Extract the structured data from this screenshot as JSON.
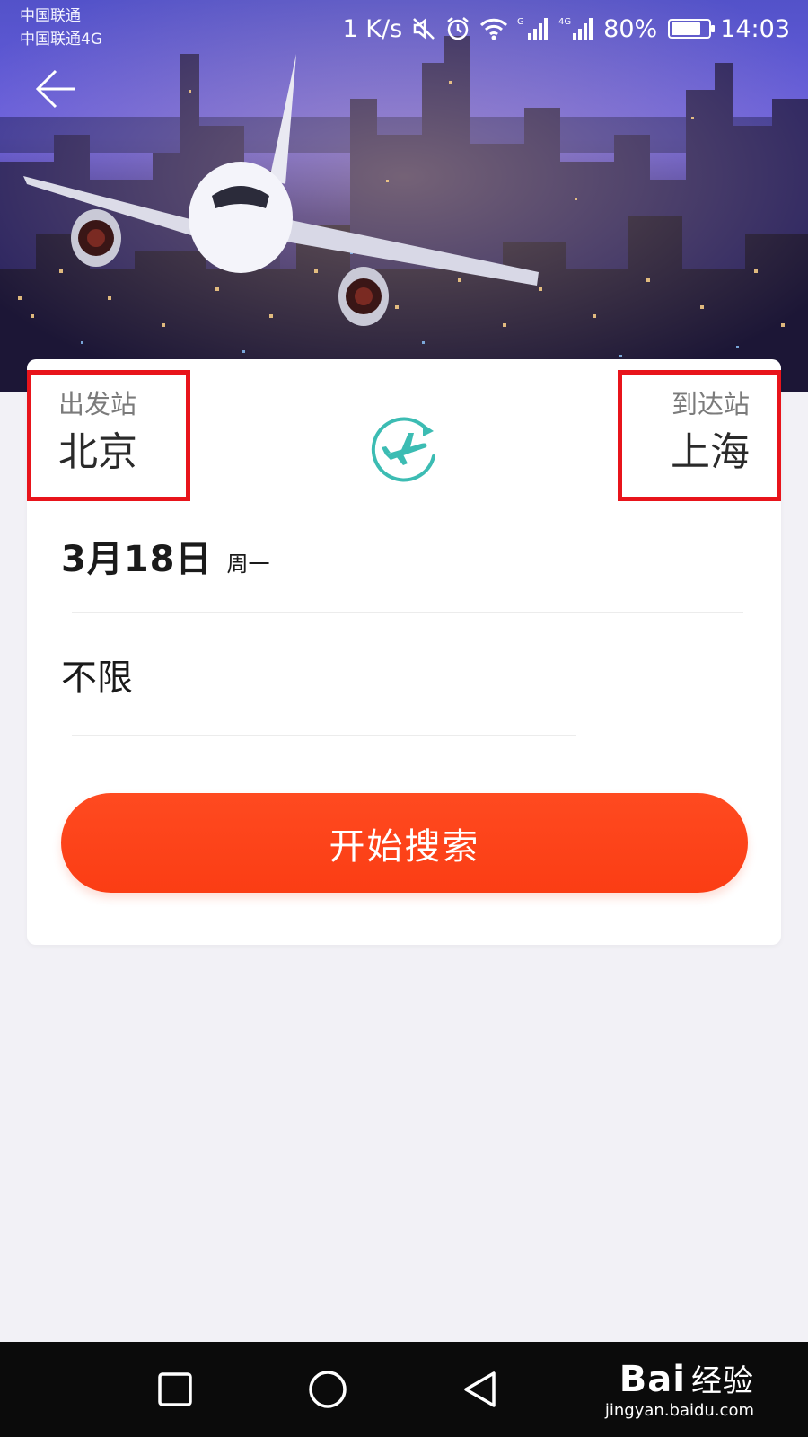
{
  "status_bar": {
    "carrier_1": "中国联通",
    "carrier_2": "中国联通4G",
    "net_speed": "1 K/s",
    "battery_percent_text": "80%",
    "battery_level": 0.8,
    "time": "14:03",
    "icons": [
      "mute-icon",
      "alarm-icon",
      "wifi-icon",
      "signal-g-icon",
      "signal-4g-icon",
      "battery-icon"
    ]
  },
  "header": {
    "back_icon": "arrow-left-icon"
  },
  "search_form": {
    "departure": {
      "label": "出发站",
      "city": "北京"
    },
    "arrival": {
      "label": "到达站",
      "city": "上海"
    },
    "swap_icon": "plane-swap-icon",
    "date": {
      "value": "3月18日",
      "weekday": "周一"
    },
    "seat_class": "不限",
    "search_button": "开始搜索"
  },
  "nav_bar": {
    "buttons": [
      "recent-apps",
      "home",
      "back"
    ]
  },
  "watermark": {
    "logo": "Bai",
    "logo_suffix": "经验",
    "url": "jingyan.baidu.com"
  },
  "colors": {
    "accent": "#fb3d14",
    "highlight_border": "#e8141b",
    "plane_icon": "#3cbcb3",
    "background": "#f2f1f6"
  }
}
